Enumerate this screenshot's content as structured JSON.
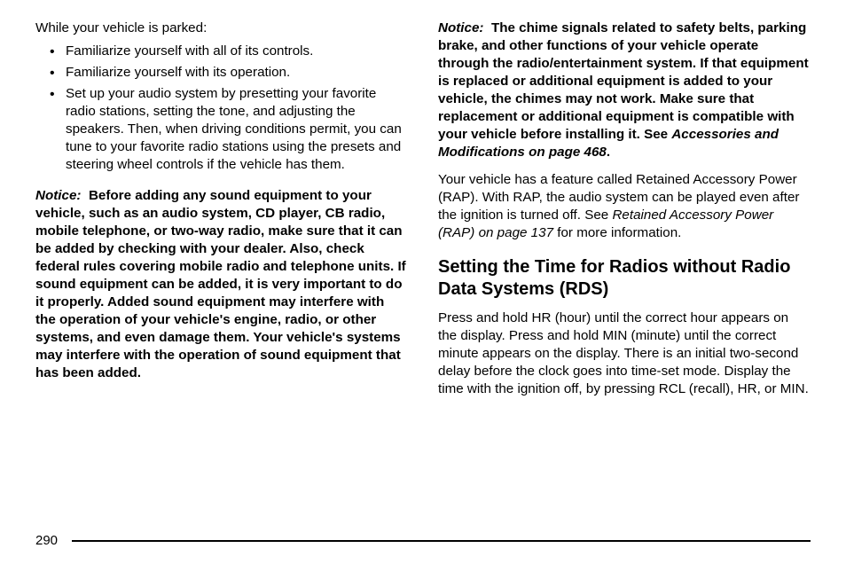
{
  "left": {
    "intro": "While your vehicle is parked:",
    "bullets": [
      "Familiarize yourself with all of its controls.",
      "Familiarize yourself with its operation.",
      "Set up your audio system by presetting your favorite radio stations, setting the tone, and adjusting the speakers. Then, when driving conditions permit, you can tune to your favorite radio stations using the presets and steering wheel controls if the vehicle has them."
    ],
    "notice_label": "Notice:",
    "notice_body": "Before adding any sound equipment to your vehicle, such as an audio system, CD player, CB radio, mobile telephone, or two-way radio, make sure that it can be added by checking with your dealer. Also, check federal rules covering mobile radio and telephone units. If sound equipment can be added, it is very important to do it properly. Added sound equipment may interfere with the operation of your vehicle's engine, radio, or other systems, and even damage them. Your vehicle's systems may interfere with the operation of sound equipment that has been added."
  },
  "right": {
    "notice_label": "Notice:",
    "notice_body_a": "The chime signals related to safety belts, parking brake, and other functions of your vehicle operate through the radio/entertainment system. If that equipment is replaced or additional equipment is added to your vehicle, the chimes may not work. Make sure that replacement or additional equipment is compatible with your vehicle before installing it. See ",
    "notice_ref": "Accessories and Modifications on page 468",
    "notice_body_b": ".",
    "rap_a": "Your vehicle has a feature called Retained Accessory Power (RAP). With RAP, the audio system can be played even after the ignition is turned off. See ",
    "rap_ref": "Retained Accessory Power (RAP) on page 137",
    "rap_b": " for more information.",
    "heading": "Setting the Time for Radios without Radio Data Systems (RDS)",
    "setting_body": "Press and hold HR (hour) until the correct hour appears on the display. Press and hold MIN (minute) until the correct minute appears on the display. There is an initial two-second delay before the clock goes into time-set mode. Display the time with the ignition off, by pressing RCL (recall), HR, or MIN."
  },
  "page_number": "290"
}
